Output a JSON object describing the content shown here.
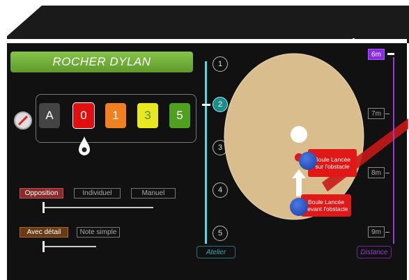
{
  "player": {
    "name": "ROCHER  DYLAN"
  },
  "scores": [
    {
      "label": "A",
      "color": "#444444"
    },
    {
      "label": "0",
      "color": "#e01010"
    },
    {
      "label": "1",
      "color": "#f08020"
    },
    {
      "label": "3",
      "color": "#e8e820"
    },
    {
      "label": "5",
      "color": "#50a020"
    }
  ],
  "selected_score": "0",
  "mode": {
    "options": [
      "Opposition",
      "Individuel",
      "Manuel"
    ],
    "selected": "Opposition"
  },
  "detail": {
    "options": [
      "Avec détail",
      "Note simple"
    ],
    "selected": "Avec détail"
  },
  "atelier": {
    "label": "Atelier",
    "steps": [
      "1",
      "2",
      "3",
      "4",
      "5"
    ],
    "active": "2"
  },
  "distance": {
    "label": "Distance",
    "marks": [
      "6m",
      "7m",
      "8m",
      "9m"
    ],
    "active": "6m"
  },
  "field": {
    "tag_top": [
      "Boule Lancée",
      "sur l'obstacle"
    ],
    "tag_bottom": [
      "Boule Lancée",
      "devant l'obstacle"
    ]
  },
  "colors": {
    "name_bar": "#6aa83a",
    "atelier_accent": "#5ad4e4",
    "distance_accent": "#9a3ad0",
    "field": "#d9bd8c",
    "ball": "#2a5ac8",
    "tag": "#e01818"
  }
}
